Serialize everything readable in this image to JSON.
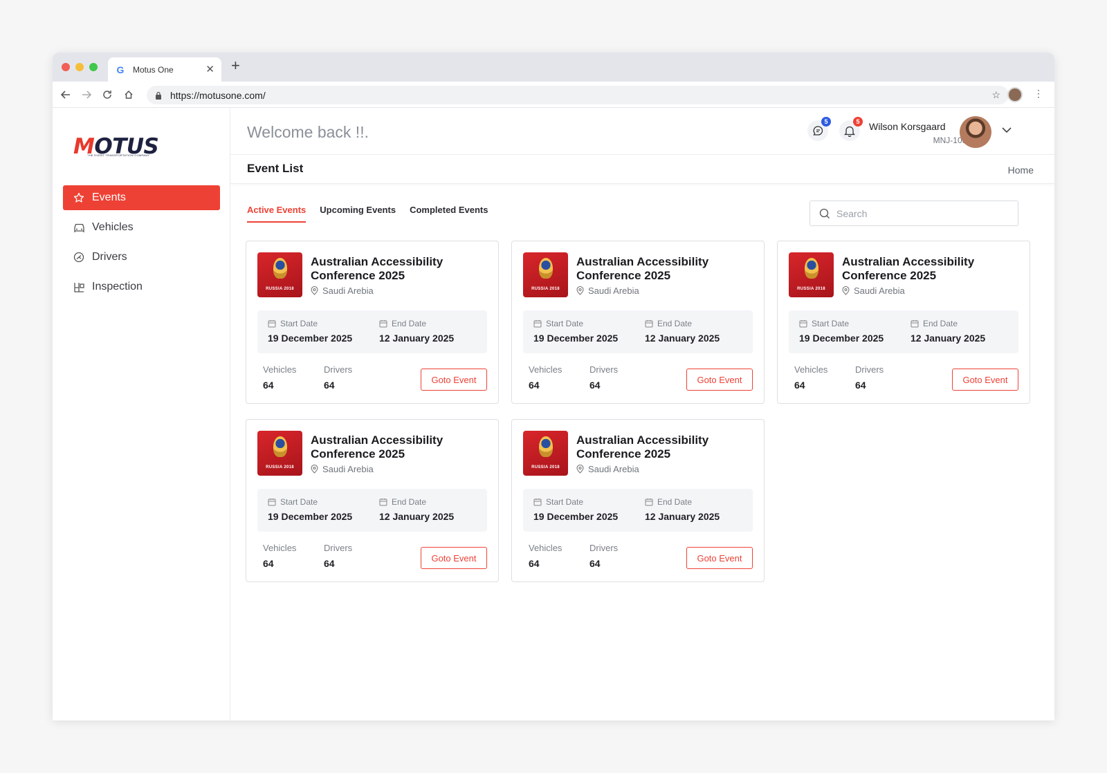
{
  "browser": {
    "tab_title": "Motus One",
    "url": "https://motusone.com/"
  },
  "app": {
    "logo": "MOTUS",
    "logo_tagline": "THE EVENT TRANSPORTATION COMPANY",
    "welcome": "Welcome back !!.",
    "accent_color": "#ee4135"
  },
  "sidebar": {
    "items": [
      {
        "label": "Events",
        "icon": "star-icon",
        "active": true
      },
      {
        "label": "Vehicles",
        "icon": "car-icon",
        "active": false
      },
      {
        "label": "Drivers",
        "icon": "steering-wheel-icon",
        "active": false
      },
      {
        "label": "Inspection",
        "icon": "inspection-icon",
        "active": false
      }
    ]
  },
  "header": {
    "messages_count": "5",
    "notifications_count": "5",
    "user_name": "Wilson Korsgaard",
    "user_id": "MNJ-1056"
  },
  "page": {
    "title": "Event List",
    "breadcrumb": "Home"
  },
  "tabs": [
    "Active Events",
    "Upcoming Events",
    "Completed Events"
  ],
  "search": {
    "placeholder": "Search"
  },
  "labels": {
    "start_date": "Start Date",
    "end_date": "End Date",
    "vehicles": "Vehicles",
    "drivers": "Drivers",
    "goto": "Goto Event",
    "thumb_text": "RUSSIA 2018"
  },
  "events": [
    {
      "title": "Australian Accessibility Conference 2025",
      "location": "Saudi Arebia",
      "start": "19 December 2025",
      "end": "12 January 2025",
      "vehicles": "64",
      "drivers": "64"
    },
    {
      "title": "Australian Accessibility Conference 2025",
      "location": "Saudi Arebia",
      "start": "19 December 2025",
      "end": "12 January 2025",
      "vehicles": "64",
      "drivers": "64"
    },
    {
      "title": "Australian Accessibility Conference 2025",
      "location": "Saudi Arebia",
      "start": "19 December 2025",
      "end": "12 January 2025",
      "vehicles": "64",
      "drivers": "64"
    },
    {
      "title": "Australian Accessibility Conference 2025",
      "location": "Saudi Arebia",
      "start": "19 December 2025",
      "end": "12 January 2025",
      "vehicles": "64",
      "drivers": "64"
    },
    {
      "title": "Australian Accessibility Conference 2025",
      "location": "Saudi Arebia",
      "start": "19 December 2025",
      "end": "12 January 2025",
      "vehicles": "64",
      "drivers": "64"
    }
  ]
}
